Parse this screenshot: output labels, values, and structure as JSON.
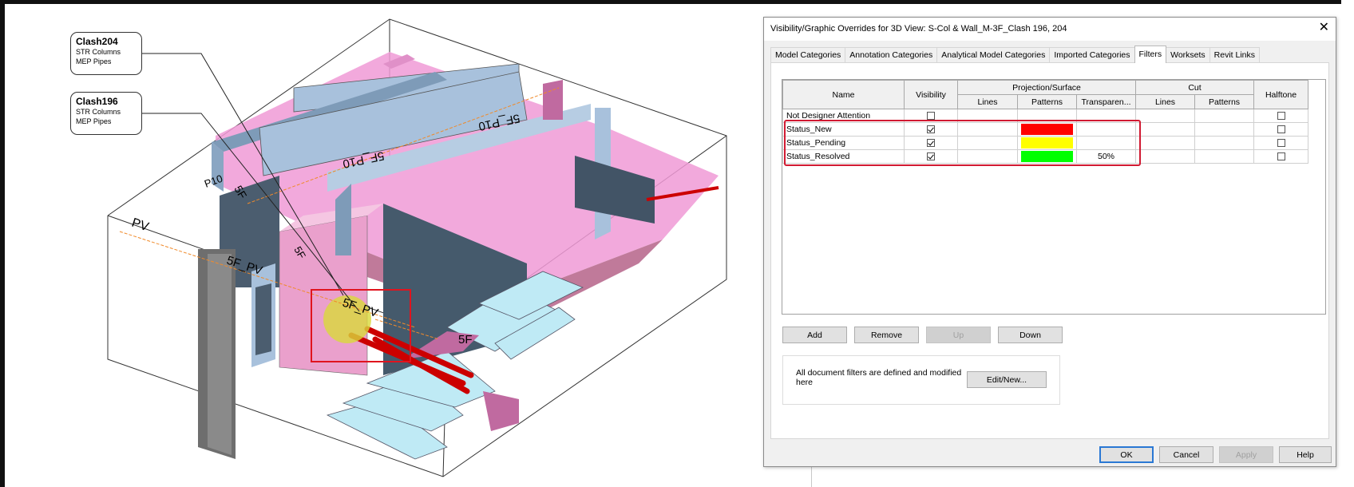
{
  "annotations": [
    {
      "title": "Clash204",
      "line1": "STR Columns",
      "line2": "MEP Pipes"
    },
    {
      "title": "Clash196",
      "line1": "STR Columns",
      "line2": "MEP Pipes"
    }
  ],
  "model_labels": {
    "pv_left": "PV",
    "sf_pv_mid": "5F_PV",
    "sf_pv_box": "5F_PV",
    "beam_a": "5F_P10",
    "beam_b": "5F_P10",
    "diag_a": "5F",
    "diag_b": "5F",
    "tag_near": "5F",
    "tag_small": "P10"
  },
  "dialog": {
    "title": "Visibility/Graphic Overrides for 3D View: S-Col & Wall_M-3F_Clash 196, 204",
    "close_icon": "close-icon",
    "tabs": [
      "Model Categories",
      "Annotation Categories",
      "Analytical Model Categories",
      "Imported Categories",
      "Filters",
      "Worksets",
      "Revit Links"
    ],
    "active_tab": "Filters",
    "table": {
      "headers": {
        "name": "Name",
        "visibility": "Visibility",
        "projection": "Projection/Surface",
        "cut": "Cut",
        "halftone": "Halftone",
        "lines": "Lines",
        "patterns": "Patterns",
        "transparency": "Transparen...",
        "cut_lines": "Lines",
        "cut_patterns": "Patterns"
      },
      "rows": [
        {
          "name": "Not Designer Attention",
          "visible": false,
          "pattern_color": "",
          "transparency": "",
          "halftone": false
        },
        {
          "name": "Status_New",
          "visible": true,
          "pattern_color": "#ff0000",
          "transparency": "",
          "halftone": false
        },
        {
          "name": "Status_Pending",
          "visible": true,
          "pattern_color": "#ffff00",
          "transparency": "",
          "halftone": false
        },
        {
          "name": "Status_Resolved",
          "visible": true,
          "pattern_color": "#00ff00",
          "transparency": "50%",
          "halftone": false
        }
      ]
    },
    "buttons": {
      "add": "Add",
      "remove": "Remove",
      "up": "Up",
      "down": "Down",
      "edit_new": "Edit/New...",
      "ok": "OK",
      "cancel": "Cancel",
      "apply": "Apply",
      "help": "Help"
    },
    "info_text": "All document filters are defined and modified here",
    "highlight_color": "#d11a32"
  }
}
